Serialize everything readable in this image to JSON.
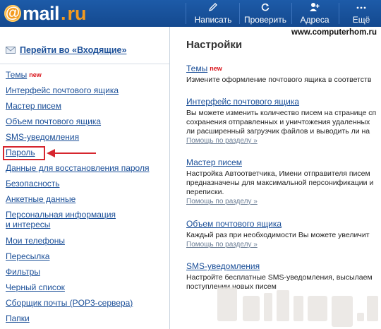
{
  "header": {
    "logo": {
      "at": "@",
      "name": "mail",
      "dot": ".",
      "tld": "ru"
    },
    "nav": [
      {
        "icon": "pencil-icon",
        "label": "Написать"
      },
      {
        "icon": "refresh-icon",
        "label": "Проверить"
      },
      {
        "icon": "add-contact-icon",
        "label": "Адреса"
      },
      {
        "icon": "more-icon",
        "label": "Ещё"
      }
    ],
    "background": "#1a549e"
  },
  "watermark": "www.computerhom.ru",
  "sidebar": {
    "inbox_link": "Перейти во «Входящие»",
    "items": [
      {
        "label": "Темы",
        "badge": "new"
      },
      {
        "label": "Интерфейс почтового ящика"
      },
      {
        "label": "Мастер писем"
      },
      {
        "label": "Объем почтового ящика"
      },
      {
        "label": "SMS-уведомления"
      },
      {
        "label": "Пароль",
        "highlighted": true
      },
      {
        "label": "Данные для восстановления пароля"
      },
      {
        "label": "Безопасность"
      },
      {
        "label": "Анкетные данные"
      },
      {
        "label": "Персональная информация",
        "label2": "и интересы"
      },
      {
        "label": "Мои телефоны"
      },
      {
        "label": "Пересылка"
      },
      {
        "label": "Фильтры"
      },
      {
        "label": "Черный список"
      },
      {
        "label": "Сборщик почты (POP3-сервера)"
      },
      {
        "label": "Папки"
      }
    ],
    "highlight_color": "#d6262e"
  },
  "main": {
    "title": "Настройки",
    "sections": [
      {
        "title": "Темы",
        "badge": "new",
        "desc": [
          "Измените оформление почтового ящика в соответств"
        ]
      },
      {
        "title": "Интерфейс почтового ящика",
        "desc": [
          "Вы можете изменить количество писем на странице сп",
          "сохранения отправленных и уничтожения удаленных",
          "ли расширенный загрузчик файлов и выводить ли на"
        ],
        "help": "Помощь по разделу »"
      },
      {
        "title": "Мастер писем",
        "desc": [
          "Настройка Автоответчика, Имени отправителя писем",
          "предназначены для максимальной персонификации и",
          "переписки."
        ],
        "help": "Помощь по разделу »"
      },
      {
        "title": "Объем почтового ящика",
        "desc": [
          "Каждый раз при необходимости Вы можете увеличит"
        ],
        "help": "Помощь по разделу »"
      },
      {
        "title": "SMS-уведомления",
        "desc": [
          "Настройте бесплатные SMS-уведомления, высылаем",
          "поступлении новых писем"
        ]
      }
    ]
  },
  "colors": {
    "link": "#1b4f98",
    "new_badge": "#d9131a",
    "help": "#6d7f96",
    "logo_accent": "#f39a1f"
  }
}
